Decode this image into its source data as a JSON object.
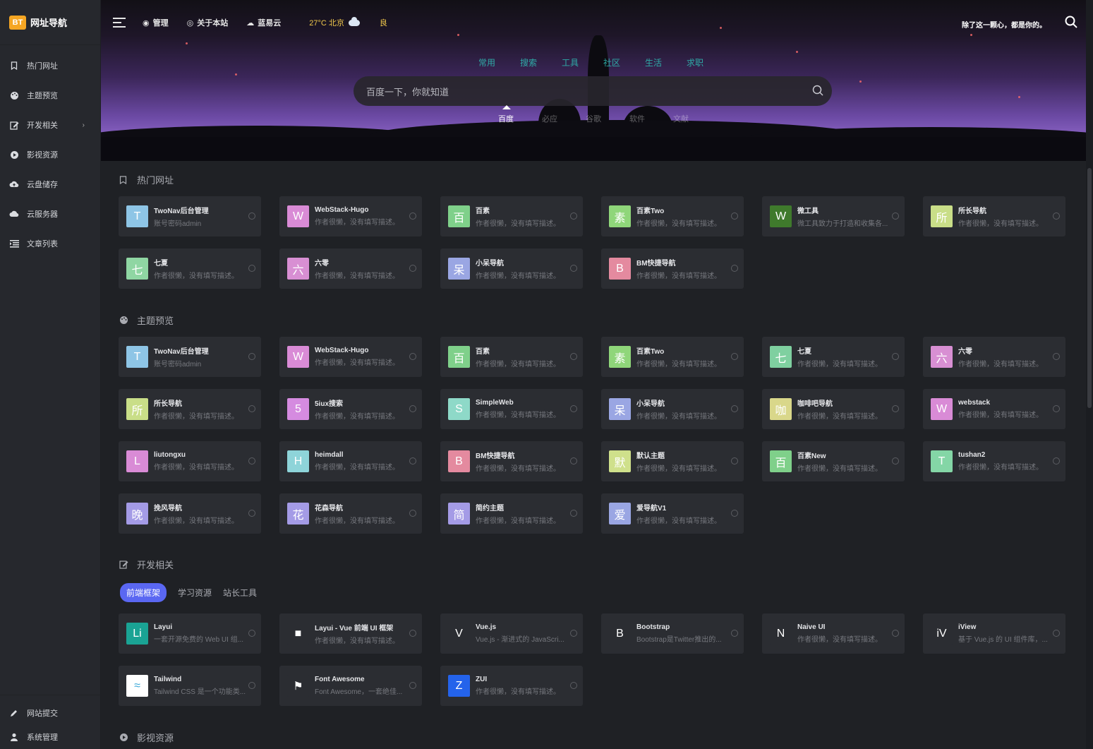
{
  "brand": {
    "badge": "BT",
    "name": "网址导航"
  },
  "sidebar": {
    "items": [
      {
        "label": "热门网址",
        "icon": "bookmark-icon"
      },
      {
        "label": "主题预览",
        "icon": "palette-icon"
      },
      {
        "label": "开发相关",
        "icon": "edit-icon",
        "arrow": "›"
      },
      {
        "label": "影视资源",
        "icon": "play-icon"
      },
      {
        "label": "云盘储存",
        "icon": "cloud-upload-icon"
      },
      {
        "label": "云服务器",
        "icon": "cloud-icon"
      },
      {
        "label": "文章列表",
        "icon": "list-icon"
      }
    ],
    "bottom": [
      {
        "label": "网站提交",
        "icon": "pencil-icon"
      },
      {
        "label": "系统管理",
        "icon": "user-icon"
      }
    ]
  },
  "topbar": {
    "links": [
      {
        "label": "管理",
        "icon": "◉"
      },
      {
        "label": "关于本站",
        "icon": "◎"
      },
      {
        "label": "蓝易云",
        "icon": "☁"
      }
    ],
    "weather": "27°C 北京",
    "air_quality": "良",
    "motto": "除了这一颗心，都是你的。"
  },
  "search": {
    "categories": [
      "常用",
      "搜索",
      "工具",
      "社区",
      "生活",
      "求职"
    ],
    "placeholder": "百度一下，你就知道",
    "engines": [
      "百度",
      "必应",
      "谷歌",
      "软件",
      "文献"
    ],
    "active_engine": "百度"
  },
  "sections": {
    "hot": {
      "title": "热门网址"
    },
    "theme": {
      "title": "主题预览"
    },
    "dev": {
      "title": "开发相关",
      "subtabs": [
        "前端框架",
        "学习资源",
        "站长工具"
      ],
      "active_subtab": "前端框架"
    },
    "video": {
      "title": "影视资源"
    }
  },
  "hot_cards": [
    {
      "letter": "T",
      "color": "#8ec5e6",
      "title": "TwoNav后台管理",
      "desc": "账号密码admin"
    },
    {
      "letter": "W",
      "color": "#d98bd6",
      "title": "WebStack-Hugo",
      "desc": "作者很懒，没有填写描述。"
    },
    {
      "letter": "百",
      "color": "#7fd08a",
      "title": "百素",
      "desc": "作者很懒，没有填写描述。"
    },
    {
      "letter": "素",
      "color": "#8fd67a",
      "title": "百素Two",
      "desc": "作者很懒，没有填写描述。"
    },
    {
      "letter": "W",
      "color": "#3f7a2c",
      "title": "微工具",
      "desc": "微工具致力于打造和收集各..."
    },
    {
      "letter": "所",
      "color": "#c9de88",
      "title": "所长导航",
      "desc": "作者很懒，没有填写描述。"
    },
    {
      "letter": "七",
      "color": "#8fd6a3",
      "title": "七夏",
      "desc": "作者很懒，没有填写描述。"
    },
    {
      "letter": "六",
      "color": "#d88fd3",
      "title": "六零",
      "desc": "作者很懒，没有填写描述。"
    },
    {
      "letter": "呆",
      "color": "#9aa6e3",
      "title": "小呆导航",
      "desc": "作者很懒，没有填写描述。"
    },
    {
      "letter": "B",
      "color": "#e48a9f",
      "title": "BM快捷导航",
      "desc": "作者很懒，没有填写描述。"
    }
  ],
  "theme_cards": [
    {
      "letter": "T",
      "color": "#8ec5e6",
      "title": "TwoNav后台管理",
      "desc": "账号密码admin"
    },
    {
      "letter": "W",
      "color": "#d98bd6",
      "title": "WebStack-Hugo",
      "desc": "作者很懒，没有填写描述。"
    },
    {
      "letter": "百",
      "color": "#7fd08a",
      "title": "百素",
      "desc": "作者很懒，没有填写描述。"
    },
    {
      "letter": "素",
      "color": "#8fd67a",
      "title": "百素Two",
      "desc": "作者很懒，没有填写描述。"
    },
    {
      "letter": "七",
      "color": "#7fd0a0",
      "title": "七夏",
      "desc": "作者很懒，没有填写描述。"
    },
    {
      "letter": "六",
      "color": "#d88fd3",
      "title": "六零",
      "desc": "作者很懒，没有填写描述。"
    },
    {
      "letter": "所",
      "color": "#c9de88",
      "title": "所长导航",
      "desc": "作者很懒，没有填写描述。"
    },
    {
      "letter": "5",
      "color": "#d58be0",
      "title": "5iux搜索",
      "desc": "作者很懒，没有填写描述。"
    },
    {
      "letter": "S",
      "color": "#8ed9c8",
      "title": "SimpleWeb",
      "desc": "作者很懒，没有填写描述。"
    },
    {
      "letter": "呆",
      "color": "#9aa6e3",
      "title": "小呆导航",
      "desc": "作者很懒，没有填写描述。"
    },
    {
      "letter": "咖",
      "color": "#d9d78a",
      "title": "咖啡吧导航",
      "desc": "作者很懒，没有填写描述。"
    },
    {
      "letter": "W",
      "color": "#d98bd6",
      "title": "webstack",
      "desc": "作者很懒，没有填写描述。"
    },
    {
      "letter": "L",
      "color": "#d98bd6",
      "title": "liutongxu",
      "desc": "作者很懒，没有填写描述。"
    },
    {
      "letter": "H",
      "color": "#8ed4d9",
      "title": "heimdall",
      "desc": "作者很懒，没有填写描述。"
    },
    {
      "letter": "B",
      "color": "#e48a9f",
      "title": "BM快捷导航",
      "desc": "作者很懒，没有填写描述。"
    },
    {
      "letter": "默",
      "color": "#cfe08b",
      "title": "默认主题",
      "desc": "作者很懒，没有填写描述。"
    },
    {
      "letter": "百",
      "color": "#7fd08a",
      "title": "百素New",
      "desc": "作者很懒，没有填写描述。"
    },
    {
      "letter": "T",
      "color": "#84d6a6",
      "title": "tushan2",
      "desc": "作者很懒，没有填写描述。"
    },
    {
      "letter": "晚",
      "color": "#a49be6",
      "title": "挽风导航",
      "desc": "作者很懒，没有填写描述。"
    },
    {
      "letter": "花",
      "color": "#a49be6",
      "title": "花森导航",
      "desc": "作者很懒，没有填写描述。"
    },
    {
      "letter": "简",
      "color": "#a49be6",
      "title": "简约主题",
      "desc": "作者很懒，没有填写描述。"
    },
    {
      "letter": "爱",
      "color": "#9aa6e3",
      "title": "爱导航V1",
      "desc": "作者很懒，没有填写描述。"
    }
  ],
  "dev_cards": [
    {
      "letter": "Li",
      "color": "#1aa394",
      "title": "Layui",
      "desc": "一套开源免费的 Web UI 组..."
    },
    {
      "letter": "■",
      "color": "#2b2d32",
      "title": "Layui - Vue 前端 UI 框架",
      "desc": "作者很懒，没有填写描述。"
    },
    {
      "letter": "V",
      "color": "#2b2d32",
      "title": "Vue.js",
      "desc": "Vue.js - 渐进式的 JavaScri..."
    },
    {
      "letter": "B",
      "color": "#2b2d32",
      "title": "Bootstrap",
      "desc": "Bootstrap是Twitter推出的..."
    },
    {
      "letter": "N",
      "color": "#2b2d32",
      "title": "Naive UI",
      "desc": "作者很懒，没有填写描述。"
    },
    {
      "letter": "iV",
      "color": "#2b2d32",
      "title": "iView",
      "desc": "基于 Vue.js 的 UI 组件库，..."
    },
    {
      "letter": "≈",
      "color": "#ffffff",
      "title": "Tailwind",
      "desc": "Tailwind CSS 是一个功能类..."
    },
    {
      "letter": "⚑",
      "color": "#2b2d32",
      "title": "Font Awesome",
      "desc": "Font Awesome，一套绝佳..."
    },
    {
      "letter": "Z",
      "color": "#2463eb",
      "title": "ZUI",
      "desc": "作者很懒，没有填写描述。"
    }
  ]
}
